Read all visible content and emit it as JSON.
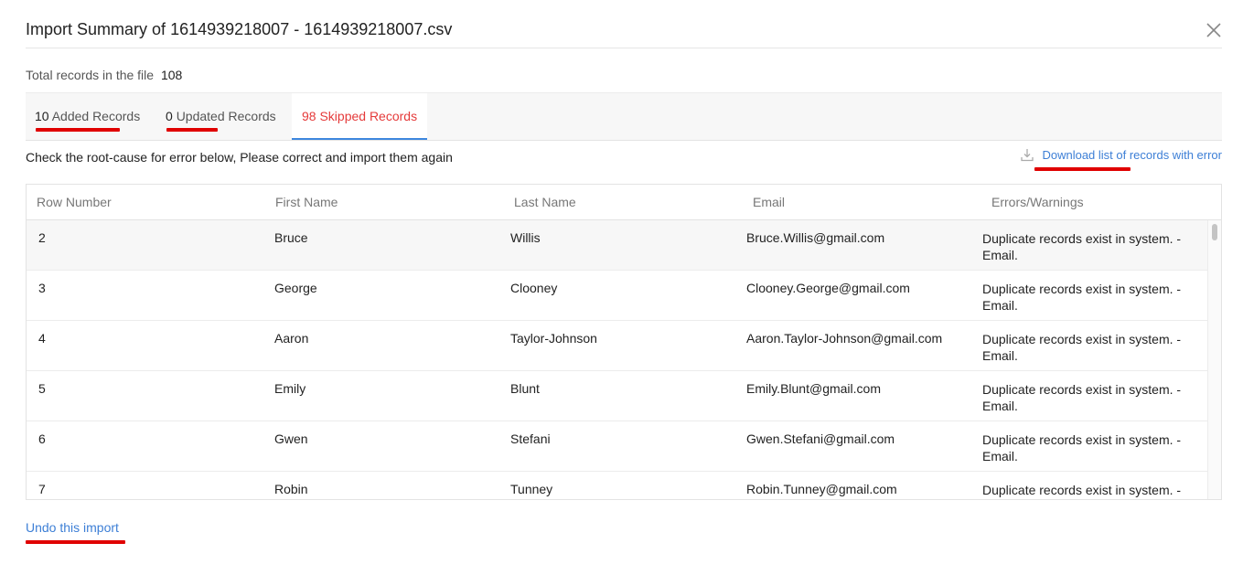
{
  "dialog": {
    "title_prefix": "Import Summary of",
    "file_name": "1614939218007 - 1614939218007.csv"
  },
  "summary": {
    "total_label": "Total records in the file",
    "total_value": "108"
  },
  "tabs": [
    {
      "count": "10",
      "label": "Added Records"
    },
    {
      "count": "0",
      "label": "Updated Records"
    },
    {
      "count": "98",
      "label": "Skipped Records",
      "active": true
    }
  ],
  "hint": "Check the root-cause for error below, Please correct and import them again",
  "download_label": "Download list of records with error",
  "table": {
    "headers": [
      "Row Number",
      "First Name",
      "Last Name",
      "Email",
      "Errors/Warnings"
    ],
    "rows": [
      [
        "2",
        "Bruce",
        "Willis",
        "Bruce.Willis@gmail.com",
        "Duplicate records exist in system. - Email."
      ],
      [
        "3",
        "George",
        "Clooney",
        "Clooney.George@gmail.com",
        "Duplicate records exist in system. - Email."
      ],
      [
        "4",
        "Aaron",
        "Taylor-Johnson",
        "Aaron.Taylor-Johnson@gmail.com",
        "Duplicate records exist in system. - Email."
      ],
      [
        "5",
        "Emily",
        "Blunt",
        "Emily.Blunt@gmail.com",
        "Duplicate records exist in system. - Email."
      ],
      [
        "6",
        "Gwen",
        "Stefani",
        "Gwen.Stefani@gmail.com",
        "Duplicate records exist in system. - Email."
      ],
      [
        "7",
        "Robin",
        "Tunney",
        "Robin.Tunney@gmail.com",
        "Duplicate records exist in system. -"
      ]
    ]
  },
  "undo_label": "Undo this import",
  "colors": {
    "accent_blue": "#3d7fd6",
    "active_tab_text": "#e53a3a",
    "tab_underline": "#3d87de",
    "annotation_red": "#e00000"
  },
  "icons": {
    "close": "close-icon",
    "download": "download-icon"
  }
}
